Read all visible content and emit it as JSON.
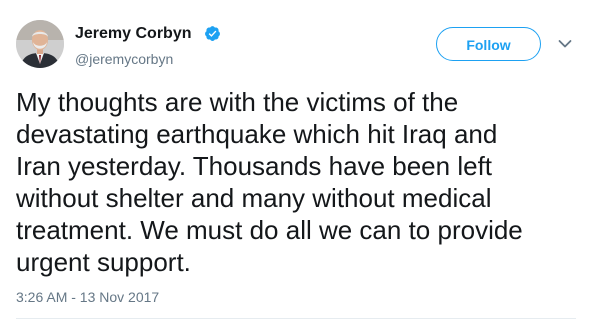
{
  "author": {
    "display_name": "Jeremy Corbyn",
    "handle": "@jeremycorbyn",
    "verified": true,
    "avatar_icon": "profile-photo"
  },
  "actions": {
    "follow_label": "Follow",
    "more_icon": "chevron-down-icon"
  },
  "tweet": {
    "text": "My thoughts are with the victims of the\ndevastating earthquake which hit Iraq and\nIran yesterday. Thousands have been left\nwithout shelter and many without medical\ntreatment. We must do all we can to provide\nurgent support.",
    "timestamp": "3:26 AM - 13 Nov 2017"
  },
  "colors": {
    "accent": "#1da1f2",
    "text": "#14171a",
    "muted": "#657786"
  }
}
